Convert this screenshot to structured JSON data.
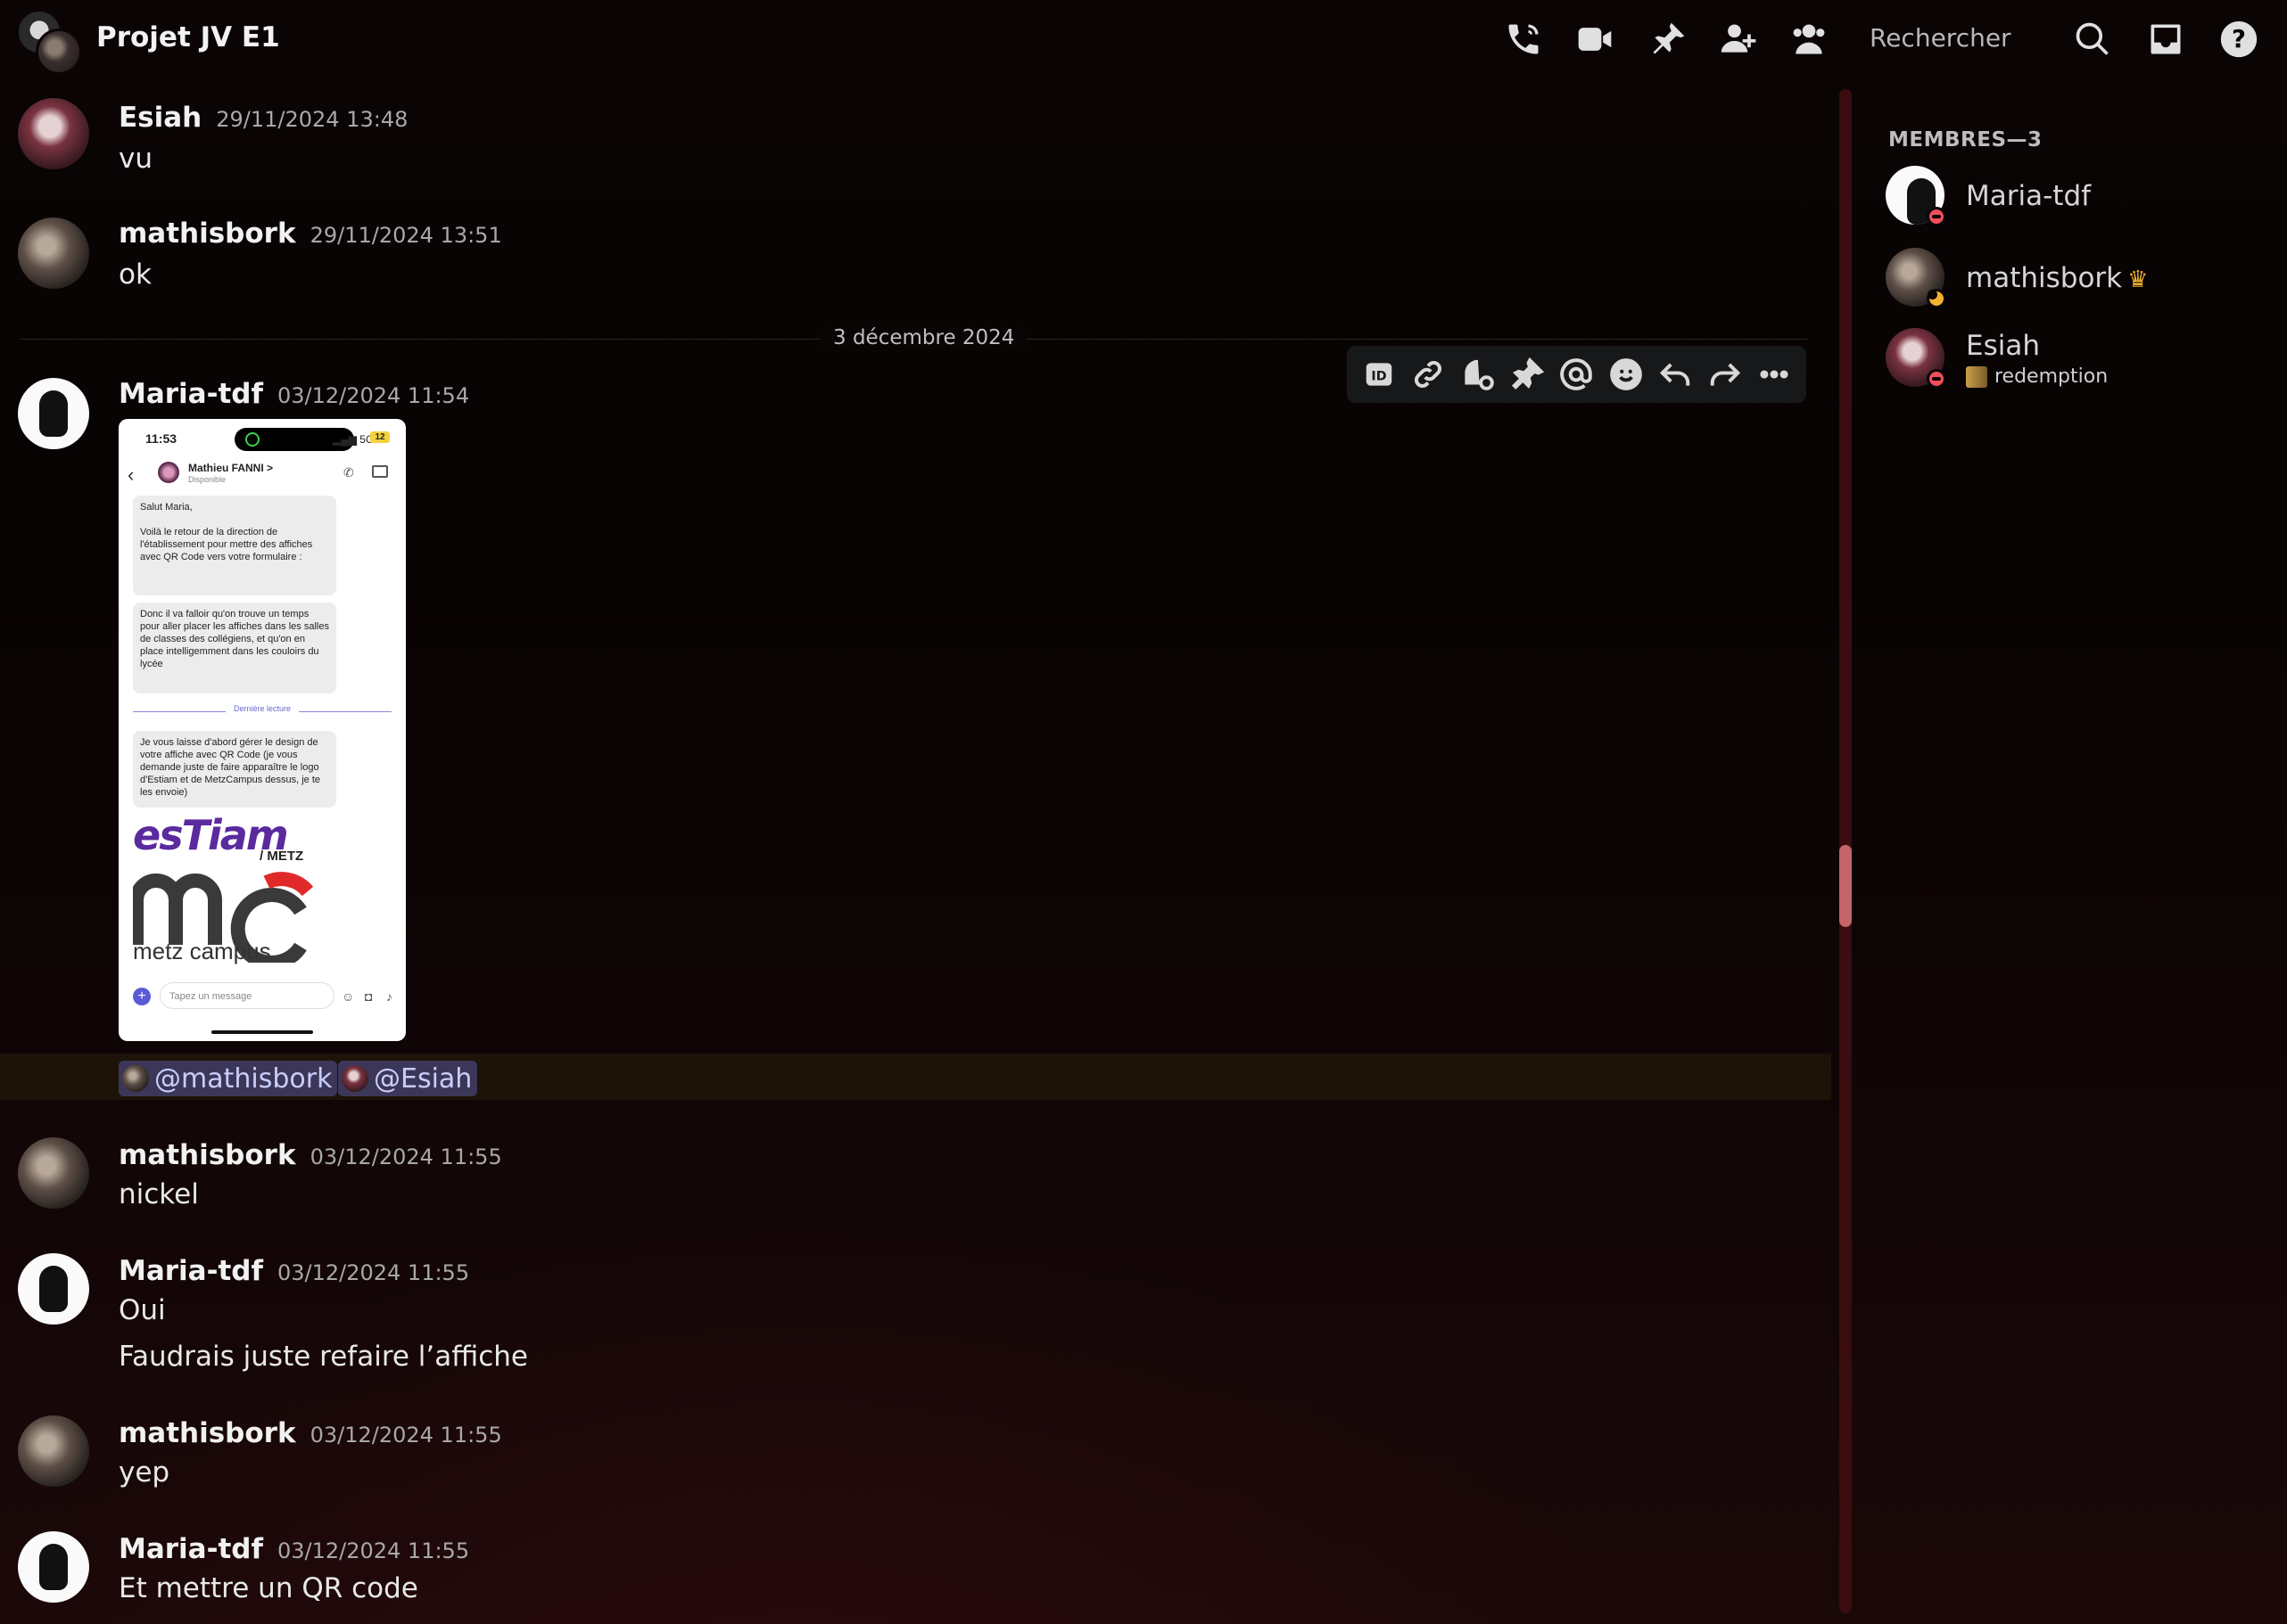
{
  "header": {
    "title": "Projet JV E1",
    "search_placeholder": "Rechercher"
  },
  "messages": [
    {
      "author": "Esiah",
      "timestamp": "29/11/2024 13:48",
      "lines": [
        "vu"
      ]
    },
    {
      "author": "mathisbork",
      "timestamp": "29/11/2024 13:51",
      "lines": [
        "ok"
      ]
    },
    {
      "author": "Maria-tdf",
      "timestamp": "03/12/2024 11:54",
      "lines": []
    },
    {
      "author": "mathisbork",
      "timestamp": "03/12/2024 11:55",
      "lines": [
        "nickel"
      ]
    },
    {
      "author": "Maria-tdf",
      "timestamp": "03/12/2024 11:55",
      "lines": [
        "Oui",
        "Faudrais juste refaire l’affiche"
      ]
    },
    {
      "author": "mathisbork",
      "timestamp": "03/12/2024 11:55",
      "lines": [
        "yep"
      ]
    },
    {
      "author": "Maria-tdf",
      "timestamp": "03/12/2024 11:55",
      "lines": [
        "Et mettre un QR code"
      ]
    }
  ],
  "date_divider": "3 décembre 2024",
  "mentions": [
    "@mathisbork",
    "@Esiah"
  ],
  "toolbar": {
    "icons": [
      "id-icon",
      "link-icon",
      "thread-icon",
      "pin-icon",
      "mention-icon",
      "emoji-icon",
      "reply-icon",
      "forward-icon",
      "more-icon"
    ],
    "id_label": "ID"
  },
  "attachment": {
    "time": "11:53",
    "signal": "5G",
    "battery": "12",
    "contact_name": "Mathieu FANNI >",
    "contact_status": "Disponible",
    "bubble1": "Salut Maria,\n\nVoilà le retour de la direction de l'établissement pour mettre des affiches avec QR Code vers votre formulaire :",
    "bubble2": "Donc il va falloir qu'on trouve un temps pour aller placer les affiches dans les salles de classes des collégiens, et qu'on en place intelligemment dans les couloirs du lycée",
    "last_read": "Dernière lecture",
    "bubble3": "Je vous laisse d'abord gérer le design de votre affiche avec QR Code (je vous demande juste de faire apparaître le logo d'Estiam et de MetzCampus dessus, je te les envoie)",
    "logo1": "esTiam",
    "logo1_sub": "/ METZ",
    "logo2": "metz campus",
    "input_placeholder": "Tapez un message"
  },
  "members": {
    "title": "MEMBRES—3",
    "list": [
      {
        "name": "Maria-tdf",
        "status": "dnd"
      },
      {
        "name": "mathisbork",
        "status": "idle",
        "owner": true
      },
      {
        "name": "Esiah",
        "status": "dnd",
        "activity": "redemption"
      }
    ]
  },
  "colors": {
    "mention_bg": "#3c3758",
    "mention_text": "#c9cdfb",
    "scroll_thumb": "#c46569",
    "dnd": "#ef4f5c",
    "idle": "#f0b232"
  }
}
